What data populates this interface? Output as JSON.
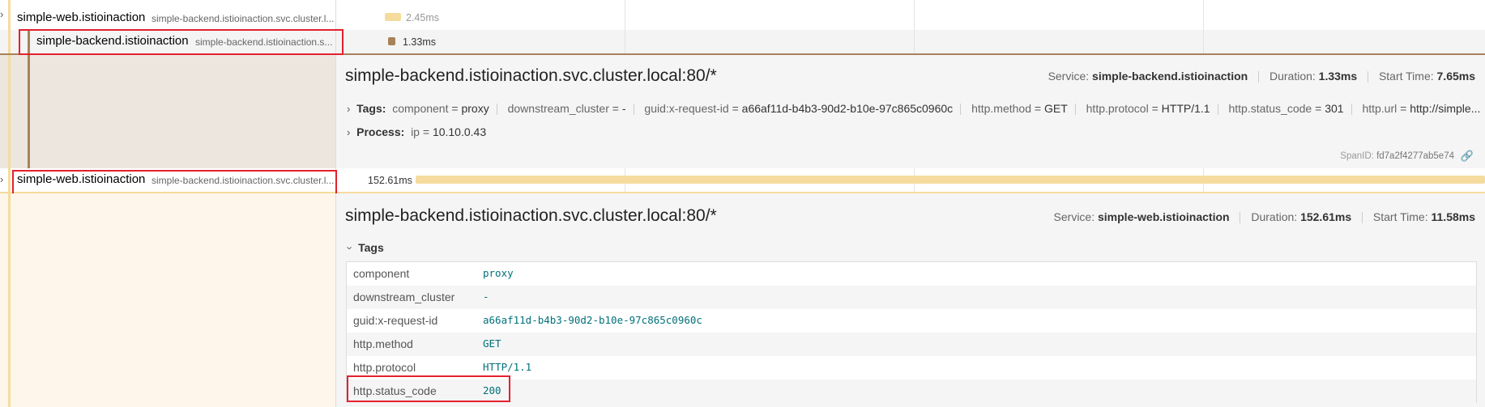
{
  "spans": [
    {
      "service": "simple-web.istioinaction",
      "operation": "simple-backend.istioinaction.svc.cluster.l...",
      "duration": "2.45ms"
    },
    {
      "service": "simple-backend.istioinaction",
      "operation": "simple-backend.istioinaction.s...",
      "duration": "1.33ms"
    },
    {
      "service": "simple-web.istioinaction",
      "operation": "simple-backend.istioinaction.svc.cluster.l...",
      "duration": "152.61ms"
    }
  ],
  "detail1": {
    "title": "simple-backend.istioinaction.svc.cluster.local:80/*",
    "service_label": "Service:",
    "service": "simple-backend.istioinaction",
    "duration_label": "Duration:",
    "duration": "1.33ms",
    "start_label": "Start Time:",
    "start": "7.65ms",
    "tags_label": "Tags:",
    "tags": [
      {
        "k": "component",
        "v": "proxy"
      },
      {
        "k": "downstream_cluster",
        "v": "-"
      },
      {
        "k": "guid:x-request-id",
        "v": "a66af11d-b4b3-90d2-b10e-97c865c0960c"
      },
      {
        "k": "http.method",
        "v": "GET"
      },
      {
        "k": "http.protocol",
        "v": "HTTP/1.1"
      },
      {
        "k": "http.status_code",
        "v": "301"
      },
      {
        "k": "http.url",
        "v": "http://simple..."
      }
    ],
    "process_label": "Process:",
    "process": [
      {
        "k": "ip",
        "v": "10.10.0.43"
      }
    ],
    "spanid_label": "SpanID:",
    "spanid": "fd7a2f4277ab5e74"
  },
  "detail2": {
    "title": "simple-backend.istioinaction.svc.cluster.local:80/*",
    "service_label": "Service:",
    "service": "simple-web.istioinaction",
    "duration_label": "Duration:",
    "duration": "152.61ms",
    "start_label": "Start Time:",
    "start": "11.58ms",
    "tags_label": "Tags",
    "tags": [
      {
        "k": "component",
        "v": "proxy"
      },
      {
        "k": "downstream_cluster",
        "v": "-"
      },
      {
        "k": "guid:x-request-id",
        "v": "a66af11d-b4b3-90d2-b10e-97c865c0960c"
      },
      {
        "k": "http.method",
        "v": "GET"
      },
      {
        "k": "http.protocol",
        "v": "HTTP/1.1"
      },
      {
        "k": "http.status_code",
        "v": "200"
      }
    ]
  },
  "colors": {
    "web": "#f5dc9e",
    "backend": "#a8825a",
    "accent_red": "#e5202e",
    "tag_value": "#00707a"
  }
}
